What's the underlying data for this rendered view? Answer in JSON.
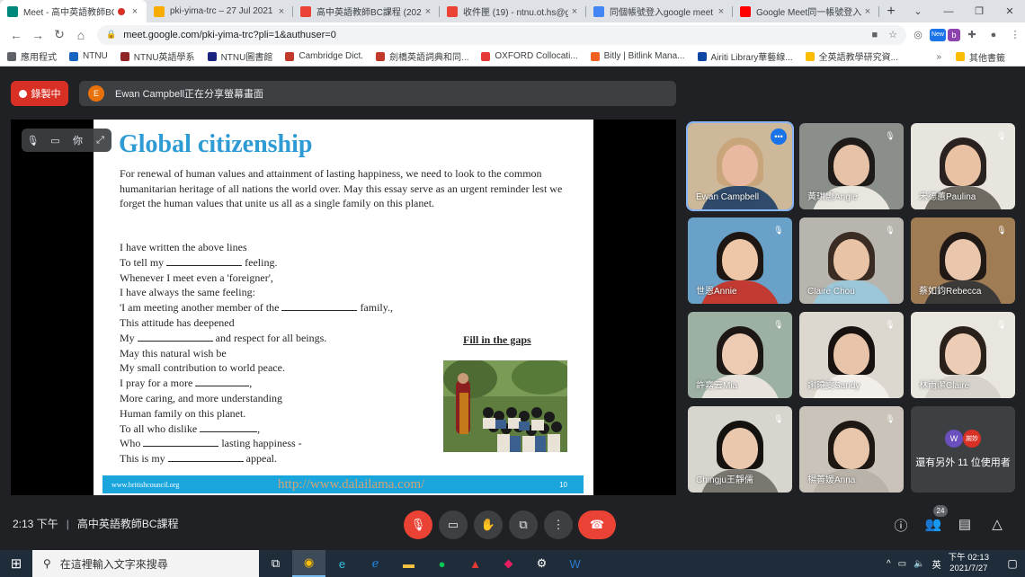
{
  "browser": {
    "tabs": [
      {
        "title": "Meet - 高中英語教師BC",
        "icon": "meet-icon",
        "color": "#00897b",
        "active": true,
        "recording": true
      },
      {
        "title": "pki-yima-trc – 27 Jul 2021 ·",
        "icon": "keep-icon",
        "color": "#f9ab00",
        "active": false
      },
      {
        "title": "高中英語教師BC課程 (2021",
        "icon": "gmail-icon",
        "color": "#ea4335",
        "active": false
      },
      {
        "title": "收件匣 (19) - ntnu.ot.hs@g",
        "icon": "gmail-icon",
        "color": "#ea4335",
        "active": false
      },
      {
        "title": "同個帳號登入google meet",
        "icon": "google-icon",
        "color": "#4285f4",
        "active": false
      },
      {
        "title": "Google Meet同一帳號登入",
        "icon": "youtube-icon",
        "color": "#ff0000",
        "active": false
      }
    ],
    "url": "meet.google.com/pki-yima-trc?pli=1&authuser=0",
    "bookmarks": [
      {
        "label": "應用程式",
        "color": "#5f6368"
      },
      {
        "label": "NTNU",
        "color": "#1565c0"
      },
      {
        "label": "NTNU英語學系",
        "color": "#8e2424"
      },
      {
        "label": "NTNU圖書館",
        "color": "#1a237e"
      },
      {
        "label": "Cambridge Dict.",
        "color": "#c0392b"
      },
      {
        "label": "劍橋英語詞典和同...",
        "color": "#c0392b"
      },
      {
        "label": "OXFORD Collocati...",
        "color": "#e53935"
      },
      {
        "label": "Bitly | Bitlink Mana...",
        "color": "#ee6123"
      },
      {
        "label": "Airiti Library華藝線...",
        "color": "#0d47a1"
      },
      {
        "label": "全英語教學研究資...",
        "color": "#fbbc04"
      }
    ],
    "other_bookmarks": "其他書籤",
    "new_badge": "New",
    "ext_b": "b"
  },
  "meet": {
    "recording_label": "錄製中",
    "presenter_initial": "E",
    "presenting_text": "Ewan Campbell正在分享螢幕畫面",
    "self_label": "你",
    "slide": {
      "title": "Global citizenship",
      "intro": "For renewal of human values and attainment of lasting happiness, we need to look to the common humanitarian heritage of all nations the world over. May this essay serve as an urgent reminder lest we forget the human values that unite us all as a single family on this planet.",
      "poem": [
        {
          "pre": "I have written the above lines",
          "gap": 0,
          "post": ""
        },
        {
          "pre": "To tell my ",
          "gap": 84,
          "post": " feeling."
        },
        {
          "pre": "Whenever I meet even a 'foreigner',",
          "gap": 0,
          "post": ""
        },
        {
          "pre": "I have always the same feeling:",
          "gap": 0,
          "post": ""
        },
        {
          "pre": "'I am meeting another member of the ",
          "gap": 84,
          "post": " family.,"
        },
        {
          "pre": "This attitude has deepened",
          "gap": 0,
          "post": ""
        },
        {
          "pre": "My ",
          "gap": 84,
          "post": " and respect for all beings."
        },
        {
          "pre": "May this natural wish be",
          "gap": 0,
          "post": ""
        },
        {
          "pre": "My small contribution to world peace.",
          "gap": 0,
          "post": ""
        },
        {
          "pre": "I pray for a more ",
          "gap": 60,
          "post": ","
        },
        {
          "pre": "More caring, and more understanding",
          "gap": 0,
          "post": ""
        },
        {
          "pre": "Human family on this planet.",
          "gap": 0,
          "post": ""
        },
        {
          "pre": "To all who dislike ",
          "gap": 64,
          "post": ","
        },
        {
          "pre": "Who ",
          "gap": 84,
          "post": " lasting happiness -"
        },
        {
          "pre": "This is my ",
          "gap": 84,
          "post": " appeal."
        }
      ],
      "fill_label": "Fill in the gaps",
      "footer_site": "www.britishcouncil.org",
      "footer_link": "http://www.dalailama.com/",
      "page_number": "10"
    },
    "participants": [
      {
        "name": "Ewan Campbell",
        "speaking": true,
        "bg": "#cdb89a",
        "skin": "#e8b9a0",
        "hair": "#c8a57a",
        "shirt": "#2f4a6b"
      },
      {
        "name": "黃琪惠Angie",
        "speaking": false,
        "bg": "#8a8f8a",
        "skin": "#e6c3a8",
        "hair": "#1e1a18",
        "shirt": "#e9e5df"
      },
      {
        "name": "宋德蕙Paulina",
        "speaking": false,
        "bg": "#e8e4de",
        "skin": "#e9c1a3",
        "hair": "#2a2220",
        "shirt": "#6f6a62"
      },
      {
        "name": "世恩Annie",
        "speaking": false,
        "bg": "#6aa1c9",
        "skin": "#edc7a8",
        "hair": "#1d1613",
        "shirt": "#c23a32"
      },
      {
        "name": "Claire Chou",
        "speaking": false,
        "bg": "#b8b4ae",
        "skin": "#e8c3a6",
        "hair": "#3a2c22",
        "shirt": "#9cc7d8"
      },
      {
        "name": "蔡如鈞Rebecca",
        "speaking": false,
        "bg": "#a07c55",
        "skin": "#e9c6ac",
        "hair": "#201915",
        "shirt": "#3c3a38"
      },
      {
        "name": "許嘉云Mia",
        "speaking": false,
        "bg": "#9cb0a4",
        "skin": "#eccbb2",
        "hair": "#1c1614",
        "shirt": "#e7e3dc"
      },
      {
        "name": "謝曉雯Sandy",
        "speaking": false,
        "bg": "#dcd8d0",
        "skin": "#e8c5aa",
        "hair": "#171210",
        "shirt": "#f2efea"
      },
      {
        "name": "林雨潔Claire",
        "speaking": false,
        "bg": "#e9e6df",
        "skin": "#ecccb4",
        "hair": "#2a211b",
        "shirt": "#d7d3cc"
      },
      {
        "name": "Chingju王靜儒",
        "speaking": false,
        "bg": "#d8d4ce",
        "skin": "#eac8ae",
        "hair": "#15110f",
        "shirt": "#7a7670"
      },
      {
        "name": "楊善媛Anna",
        "speaking": false,
        "bg": "#c9c3b9",
        "skin": "#e7c6ac",
        "hair": "#1e1814",
        "shirt": "#b9b2a8"
      }
    ],
    "more": {
      "label": "還有另外 11 位使用者",
      "avatar1": "W",
      "avatar1_color": "#6a4fbf",
      "avatar2": "謝妙",
      "avatar2_color": "#d93025"
    },
    "time": "2:13 下午",
    "meeting_name": "高中英語教師BC課程",
    "people_count": "24"
  },
  "taskbar": {
    "search_placeholder": "在這裡輸入文字來搜尋",
    "ime": "英",
    "time": "下午 02:13",
    "date": "2021/7/27"
  }
}
